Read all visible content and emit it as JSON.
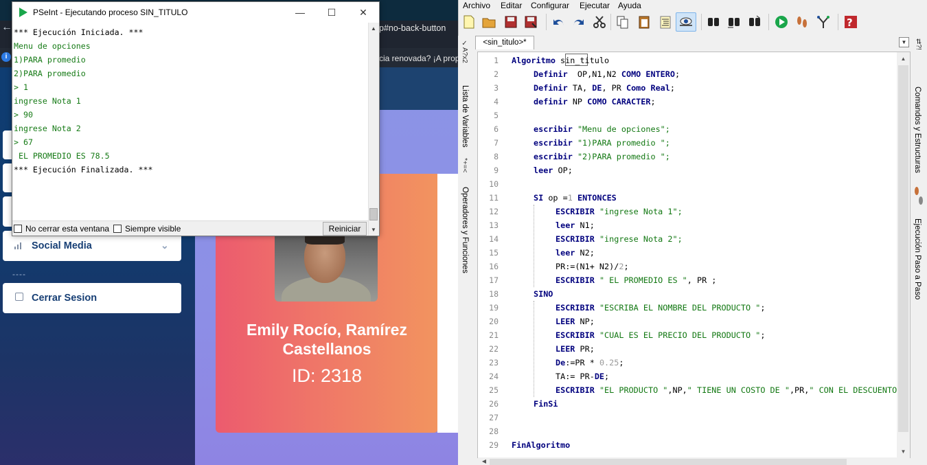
{
  "browser": {
    "url_fragment": "p#no-back-button",
    "info_text": "cia renovada? ¡A prop",
    "sidebar": {
      "social_label": "Social Media",
      "separator": "----",
      "logout_label": "Cerrar Sesion"
    },
    "profile": {
      "name": "Emily Rocío, Ramírez Castellanos",
      "id": "ID: 2318"
    }
  },
  "run_window": {
    "title": "PSeInt - Ejecutando proceso SIN_TITULO",
    "console": [
      {
        "text": "*** Ejecución Iniciada. ***",
        "kind": "sys"
      },
      {
        "text": "Menu de opciones",
        "kind": "out"
      },
      {
        "text": "1)PARA promedio",
        "kind": "out"
      },
      {
        "text": "2)PARA promedio",
        "kind": "out"
      },
      {
        "text": "> 1",
        "kind": "out"
      },
      {
        "text": "ingrese Nota 1",
        "kind": "out"
      },
      {
        "text": "> 90",
        "kind": "out"
      },
      {
        "text": "ingrese Nota 2",
        "kind": "out"
      },
      {
        "text": "> 67",
        "kind": "out"
      },
      {
        "text": " EL PROMEDIO ES 78.5",
        "kind": "out"
      },
      {
        "text": "*** Ejecución Finalizada. ***",
        "kind": "sys"
      }
    ],
    "checkbox_keep_open": "No cerrar esta ventana",
    "checkbox_always_visible": "Siempre visible",
    "restart_button": "Reiniciar"
  },
  "ide": {
    "menu": [
      "Archivo",
      "Editar",
      "Configurar",
      "Ejecutar",
      "Ayuda"
    ],
    "doc_tab": "<sin_titulo>*",
    "left_panels": [
      "Lista de Variables",
      "Operadores y Funciones"
    ],
    "right_panels": [
      "Comandos y Estructuras",
      "Ejecución Paso a Paso"
    ],
    "code_lines": [
      "1",
      "2",
      "3",
      "4",
      "5",
      "6",
      "7",
      "8",
      "9",
      "10",
      "11",
      "12",
      "13",
      "14",
      "15",
      "16",
      "17",
      "18",
      "19",
      "20",
      "21",
      "22",
      "23",
      "24",
      "25",
      "26",
      "27",
      "28",
      "29"
    ],
    "code": {
      "l1_kw": "Algoritmo",
      "l1_name": "sin_titulo",
      "l2": "Definir  OP,N1,N2 COMO ENTERO;",
      "l3": "Definir TA, DE, PR Como Real;",
      "l4": "definir NP COMO CARACTER;",
      "l6_kw": "escribir",
      "l6_s": "\"Menu de opciones\";",
      "l7_kw": "escribir",
      "l7_s": "\"1)PARA promedio \";",
      "l8_kw": "escribir",
      "l8_s": "\"2)PARA promedio \";",
      "l9_kw": "leer",
      "l9_r": "OP;",
      "l11_kw": "SI",
      "l11_r": "op =",
      "l11_n": "1",
      "l11_kw2": "ENTONCES",
      "l12_kw": "ESCRIBIR",
      "l12_s": "\"ingrese Nota 1\";",
      "l13_kw": "leer",
      "l13_r": "N1;",
      "l14_kw": "ESCRIBIR",
      "l14_s": "\"ingrese Nota 2\";",
      "l15_kw": "leer",
      "l15_r": "N2;",
      "l16_a": "PR:=(N1+ N2)/",
      "l16_n": "2",
      "l16_b": ";",
      "l17_kw": "ESCRIBIR",
      "l17_s": "\" EL PROMEDIO ES \"",
      "l17_r": ", PR ;",
      "l18_kw": "SINO",
      "l19_kw": "ESCRIBIR",
      "l19_s": "\"ESCRIBA EL NOMBRE DEL PRODUCTO \"",
      "l19_r": ";",
      "l20_kw": "LEER",
      "l20_r": "NP;",
      "l21_kw": "ESCRIBIR",
      "l21_s": "\"CUAL ES EL PRECIO DEL PRODUCTO \"",
      "l21_r": ";",
      "l22_kw": "LEER",
      "l22_r": "PR;",
      "l23_kw": "De",
      "l23_a": ":=PR * ",
      "l23_n": "0.25",
      "l23_b": ";",
      "l24_a": "TA:= PR-",
      "l24_kw": "DE",
      "l24_b": ";",
      "l25_kw": "ESCRIBIR",
      "l25_s1": "\"EL PRODUCTO \"",
      "l25_a": ",NP,",
      "l25_s2": "\" TIENE UN COSTO DE \"",
      "l25_b": ",PR,",
      "l25_s3": "\" CON EL DESCUENTO",
      "l27_kw": "FinSi",
      "l29_kw": "FinAlgoritmo"
    }
  }
}
